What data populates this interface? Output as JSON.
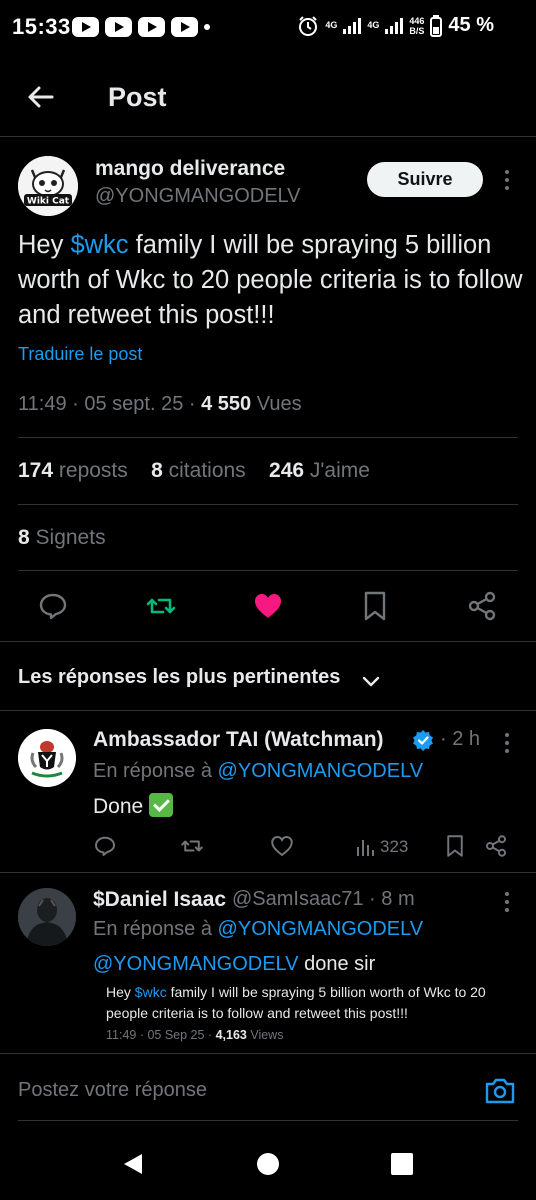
{
  "status_bar": {
    "time": "15:33",
    "net1": "4G",
    "net2": "4G",
    "speed_value": "446",
    "speed_unit": "B/S",
    "battery": "45 %"
  },
  "header": {
    "title": "Post"
  },
  "post": {
    "author_name": "mango deliverance",
    "author_handle": "@YONGMANGODELV",
    "avatar_caption": "Wiki Cat",
    "follow_label": "Suivre",
    "text_before": "Hey ",
    "cashtag": "$wkc",
    "text_after": " family I will be spraying 5 billion worth of Wkc to 20 people criteria is to follow and retweet this post!!!",
    "translate_label": "Traduire le post",
    "time": "11:49",
    "date": "05 sept. 25",
    "views_count": "4 550",
    "views_label": "Vues",
    "reposts_count": "174",
    "reposts_label": "reposts",
    "quotes_count": "8",
    "quotes_label": "citations",
    "likes_count": "246",
    "likes_label": "J'aime",
    "bookmarks_count": "8",
    "bookmarks_label": "Signets"
  },
  "sort_label": "Les réponses les plus pertinentes",
  "replies": [
    {
      "name": "Ambassador TAI (Watchman)",
      "time": "2 h",
      "reply_to_label": "En réponse à",
      "reply_to": "@YONGMANGODELV",
      "text": "Done",
      "views": "323"
    },
    {
      "name": "$Daniel Isaac",
      "handle": "@SamIsaac71",
      "time": "8 m",
      "reply_to_label": "En réponse à",
      "reply_to": "@YONGMANGODELV",
      "mention": "@YONGMANGODELV",
      "text": " done sir",
      "embed_before": "Hey ",
      "embed_cashtag": "$wkc",
      "embed_after": " family I will be spraying 5 billion worth of Wkc to 20 people criteria is to follow and retweet this post!!!",
      "embed_time": "11:49 · 05 Sep 25 · ",
      "embed_views": "4,163",
      "embed_views_label": " Views"
    }
  ],
  "compose": {
    "placeholder": "Postez votre réponse"
  },
  "colors": {
    "accent": "#1d9bf0",
    "like": "#f91880",
    "repost": "#00ba7c"
  }
}
